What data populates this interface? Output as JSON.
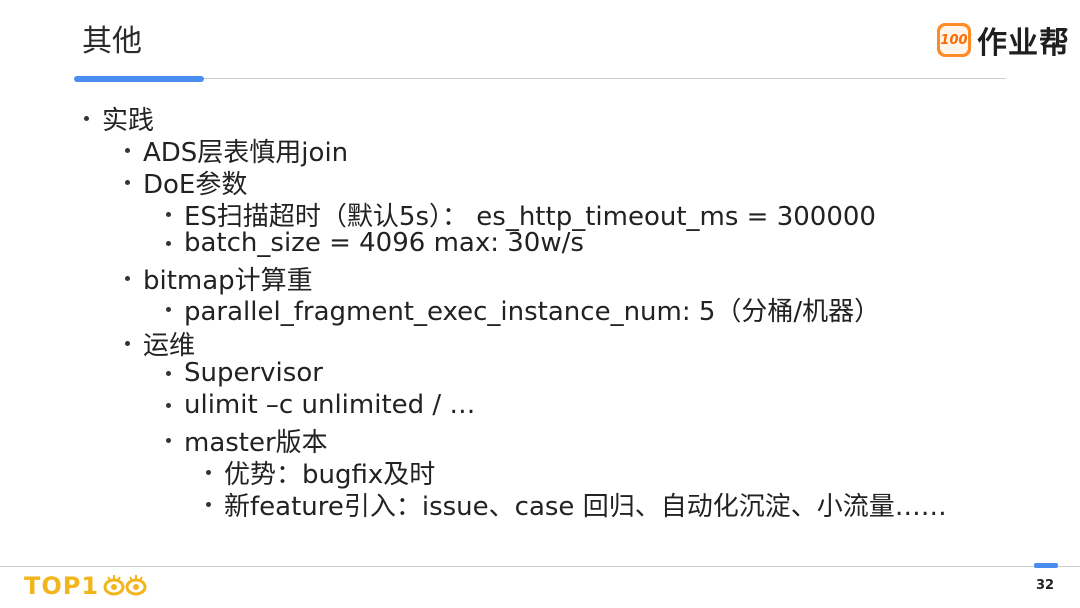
{
  "header": {
    "title": "其他",
    "logo_badge": "100",
    "logo_text": "作业帮"
  },
  "items": [
    {
      "level": 1,
      "text": "实践"
    },
    {
      "level": 2,
      "text": "ADS层表慎用join"
    },
    {
      "level": 2,
      "text": "DoE参数"
    },
    {
      "level": 3,
      "text": "ES扫描超时（默认5s）： es_http_timeout_ms = 300000"
    },
    {
      "level": 3,
      "text": "batch_size = 4096 max: 30w/s"
    },
    {
      "level": 2,
      "text": "bitmap计算重"
    },
    {
      "level": 3,
      "text": "parallel_fragment_exec_instance_num: 5（分桶/机器）"
    },
    {
      "level": 2,
      "text": "运维"
    },
    {
      "level": 3,
      "text": "Supervisor"
    },
    {
      "level": 3,
      "text": "ulimit –c unlimited / …"
    },
    {
      "level": 3,
      "text": "master版本"
    },
    {
      "level": 4,
      "text": "优势：bugfix及时"
    },
    {
      "level": 4,
      "text": "新feature引入：issue、case 回归、自动化沉淀、小流量……"
    }
  ],
  "footer": {
    "brand_text": "TOP1",
    "page_number": "32"
  },
  "colors": {
    "accent": "#4a8df0",
    "brand": "#f2b51c",
    "logo": "#ff8a26"
  }
}
